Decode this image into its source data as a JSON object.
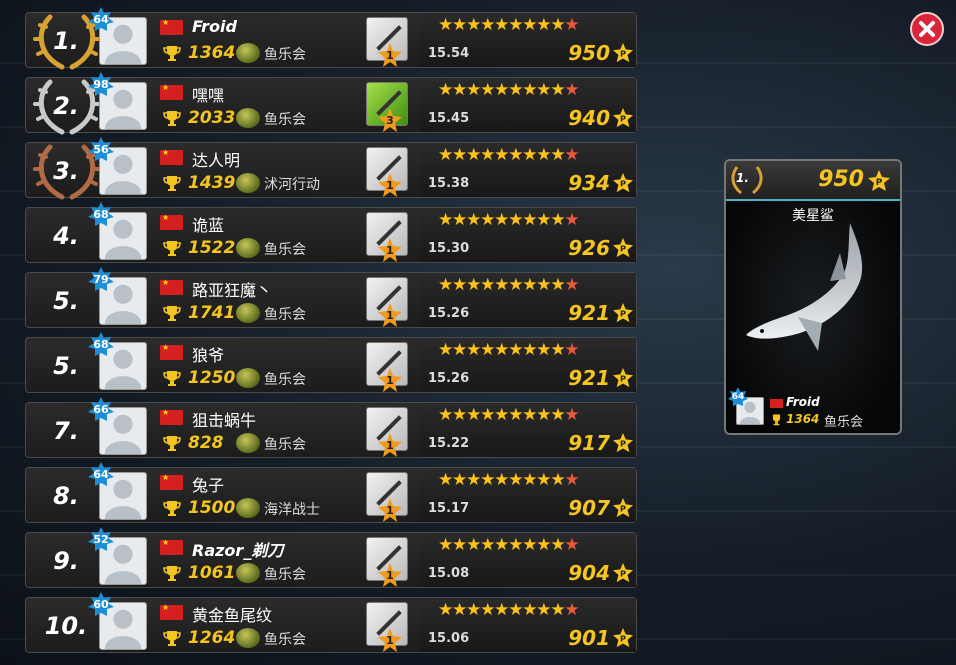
{
  "leaderboard": [
    {
      "rank": "1.",
      "medal": "gold",
      "level": "64",
      "name": "Froid",
      "latin": true,
      "trophies": "1364",
      "club": "鱼乐会",
      "rod_rank": "1",
      "rod_color": "white",
      "weight": "15.54",
      "points": "950",
      "stars_filled": 9
    },
    {
      "rank": "2.",
      "medal": "silver",
      "level": "98",
      "name": "嘿嘿",
      "latin": false,
      "trophies": "2033",
      "club": "鱼乐会",
      "rod_rank": "3",
      "rod_color": "green",
      "weight": "15.45",
      "points": "940",
      "stars_filled": 9
    },
    {
      "rank": "3.",
      "medal": "bronze",
      "level": "56",
      "name": "达人明",
      "latin": false,
      "trophies": "1439",
      "club": "沭河行动",
      "rod_rank": "1",
      "rod_color": "white",
      "weight": "15.38",
      "points": "934",
      "stars_filled": 9
    },
    {
      "rank": "4.",
      "medal": "none",
      "level": "68",
      "name": "诡蓝",
      "latin": false,
      "trophies": "1522",
      "club": "鱼乐会",
      "rod_rank": "1",
      "rod_color": "white",
      "weight": "15.30",
      "points": "926",
      "stars_filled": 9
    },
    {
      "rank": "5.",
      "medal": "none",
      "level": "79",
      "name": "路亚狂魔丶",
      "latin": false,
      "trophies": "1741",
      "club": "鱼乐会",
      "rod_rank": "1",
      "rod_color": "white",
      "weight": "15.26",
      "points": "921",
      "stars_filled": 9
    },
    {
      "rank": "5.",
      "medal": "none",
      "level": "68",
      "name": "狼爷",
      "latin": false,
      "trophies": "1250",
      "club": "鱼乐会",
      "rod_rank": "1",
      "rod_color": "white",
      "weight": "15.26",
      "points": "921",
      "stars_filled": 9
    },
    {
      "rank": "7.",
      "medal": "none",
      "level": "66",
      "name": "狙击蜗牛",
      "latin": false,
      "trophies": "828",
      "club": "鱼乐会",
      "rod_rank": "1",
      "rod_color": "white",
      "weight": "15.22",
      "points": "917",
      "stars_filled": 9
    },
    {
      "rank": "8.",
      "medal": "none",
      "level": "64",
      "name": "兔子",
      "latin": false,
      "trophies": "1500",
      "club": "海洋战士",
      "rod_rank": "1",
      "rod_color": "white",
      "weight": "15.17",
      "points": "907",
      "stars_filled": 9
    },
    {
      "rank": "9.",
      "medal": "none",
      "level": "52",
      "name": "Razor_剃刀",
      "latin": true,
      "trophies": "1061",
      "club": "鱼乐会",
      "rod_rank": "1",
      "rod_color": "white",
      "weight": "15.08",
      "points": "904",
      "stars_filled": 9
    },
    {
      "rank": "10.",
      "medal": "none",
      "level": "60",
      "name": "黄金鱼尾纹",
      "latin": false,
      "trophies": "1264",
      "club": "鱼乐会",
      "rod_rank": "1",
      "rod_color": "white",
      "weight": "15.06",
      "points": "901",
      "stars_filled": 9
    }
  ],
  "card": {
    "rank": "1.",
    "points": "950",
    "fish_name": "美星鲨",
    "player": {
      "level": "64",
      "name": "Froid",
      "trophies": "1364",
      "club": "鱼乐会"
    }
  },
  "colors": {
    "gold": "#d8a233",
    "silver": "#c9c9c9",
    "bronze": "#b06a45",
    "points": "#f5c520",
    "level_badge": "#1e8fd6"
  },
  "icons": {
    "close": "close-icon",
    "trophy": "trophy-icon",
    "points": "points-icon",
    "flag": "china-flag-icon"
  }
}
